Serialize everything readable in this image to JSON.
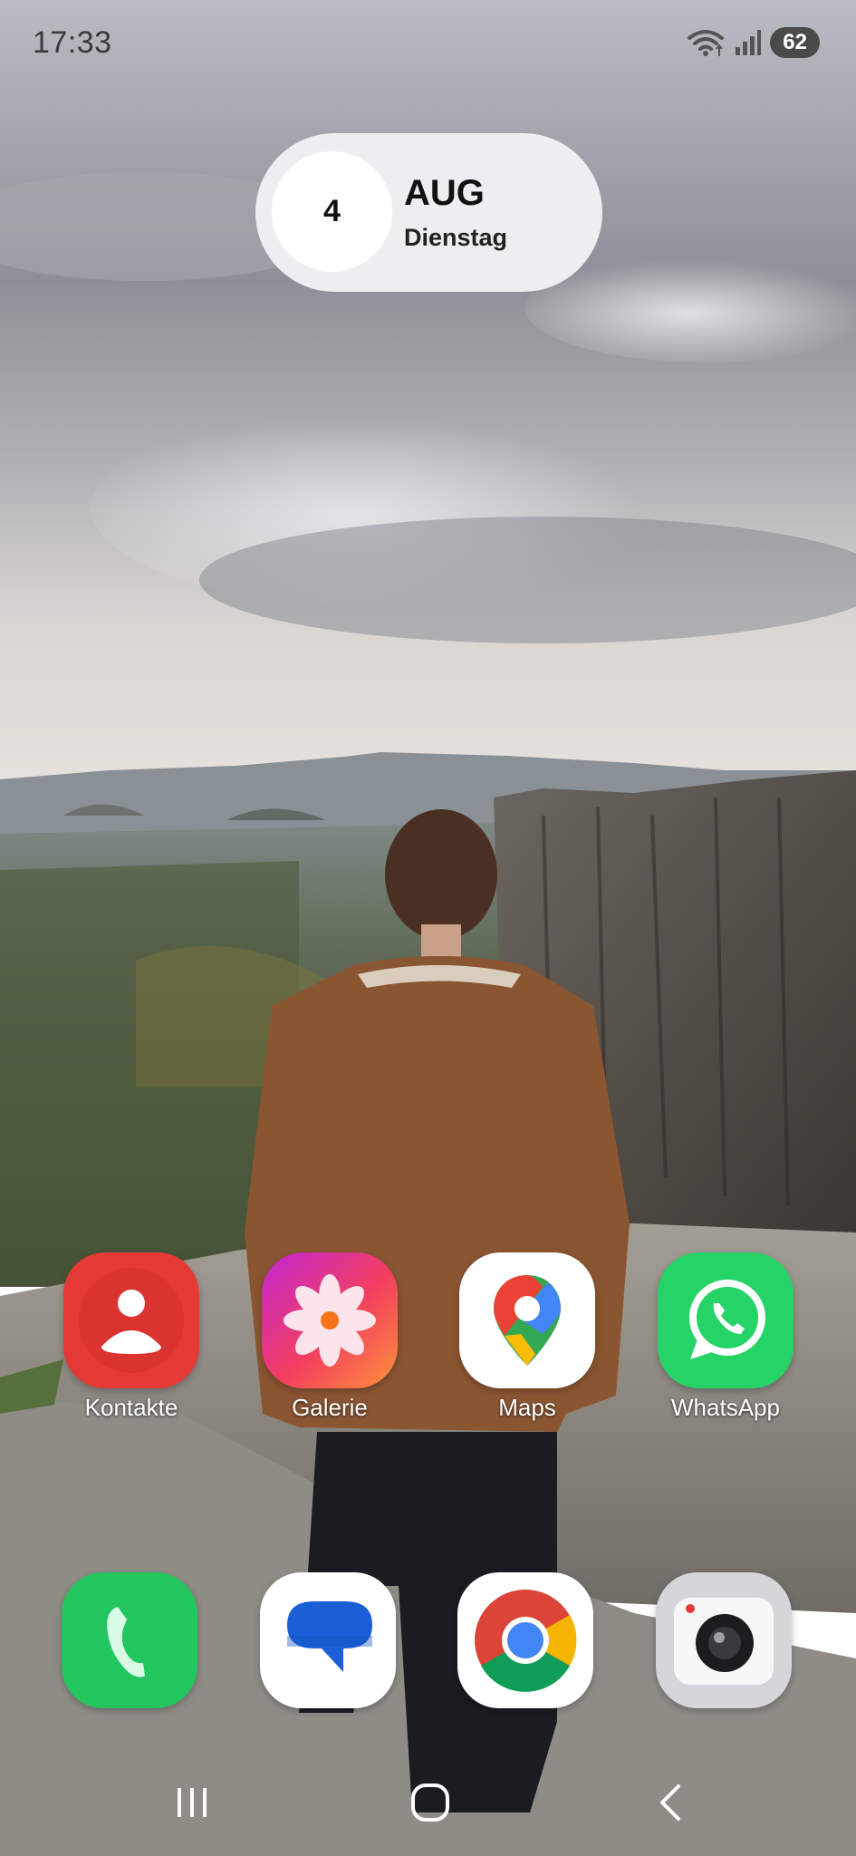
{
  "status_bar": {
    "time": "17:33",
    "battery": "62",
    "icons": [
      "wifi-icon",
      "signal-icon",
      "battery-icon"
    ]
  },
  "date_widget": {
    "day": "4",
    "month": "AUG",
    "weekday": "Dienstag"
  },
  "apps_row": [
    {
      "label": "Kontakte",
      "icon": "contacts-icon"
    },
    {
      "label": "Galerie",
      "icon": "gallery-icon"
    },
    {
      "label": "Maps",
      "icon": "maps-icon"
    },
    {
      "label": "WhatsApp",
      "icon": "whatsapp-icon"
    }
  ],
  "dock": [
    {
      "icon": "phone-icon"
    },
    {
      "icon": "messages-icon"
    },
    {
      "icon": "chrome-icon"
    },
    {
      "icon": "camera-icon"
    }
  ],
  "nav_bar": {
    "icons": [
      "recents-icon",
      "home-icon",
      "back-icon"
    ]
  },
  "colors": {
    "contacts": "#e53935",
    "whatsapp": "#25d366",
    "phone": "#22c55e",
    "messages": "#1a5fd6"
  }
}
